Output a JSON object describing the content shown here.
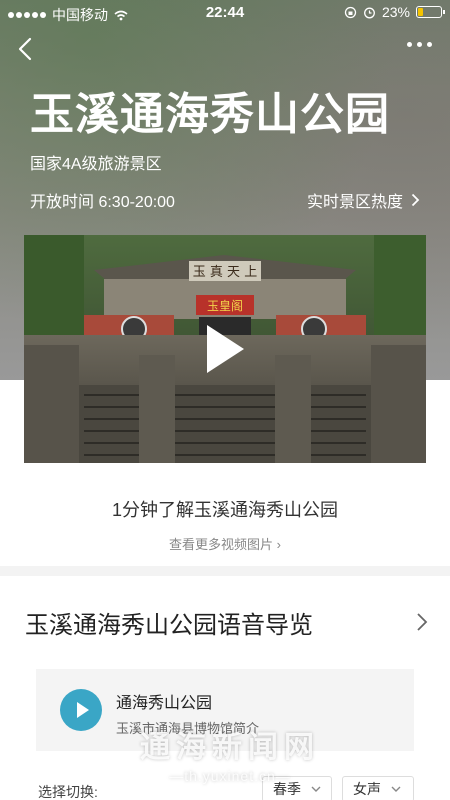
{
  "status_bar": {
    "carrier": "中国移动",
    "time": "22:44",
    "battery": "23%",
    "battery_level": 0.23
  },
  "header": {
    "title": "玉溪通海秀山公园",
    "level": "国家4A级旅游景区",
    "hours": "开放时间 6:30-20:00",
    "heat_link": "实时景区热度"
  },
  "video": {
    "caption": "1分钟了解玉溪通海秀山公园",
    "more_link": "查看更多视频图片",
    "gate_plaque_top": "玉 真 天 上",
    "gate_plaque_center": "玉皇阁"
  },
  "guide": {
    "title": "玉溪通海秀山公园语音导览",
    "audio_name": "通海秀山公园",
    "audio_desc": "玉溪市通海县博物馆简介"
  },
  "switch": {
    "label": "选择切换:",
    "season": "春季",
    "voice": "女声"
  },
  "watermark": {
    "cn": "通海新闻网",
    "url": "—th.yuxinet.cn—"
  }
}
